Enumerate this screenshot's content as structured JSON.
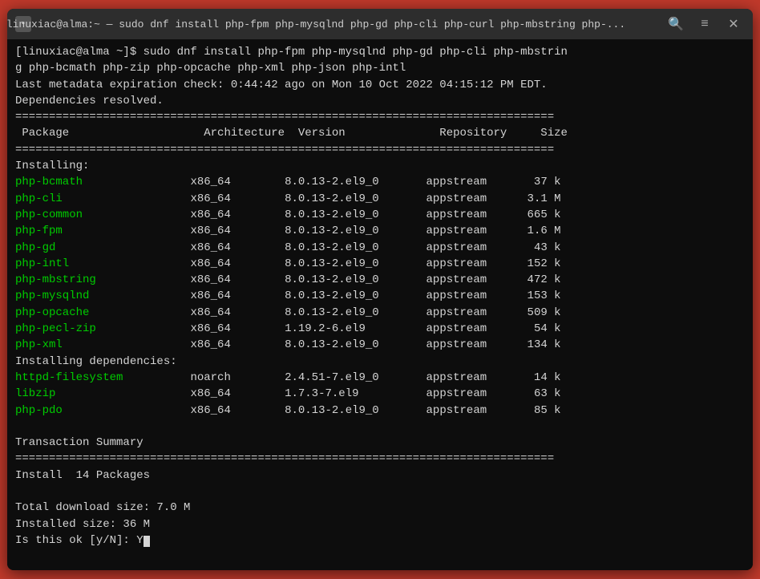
{
  "titleBar": {
    "icon": "■",
    "title": "linuxiac@alma:~ — sudo dnf install php-fpm php-mysqlnd php-gd php-cli php-curl php-mbstring php-...",
    "searchIcon": "🔍",
    "menuIcon": "≡",
    "closeIcon": "✕"
  },
  "terminal": {
    "lines": [
      {
        "type": "prompt",
        "text": "[linuxiac@alma ~]$ sudo dnf install php-fpm php-mysqlnd php-gd php-cli php-mbstrin"
      },
      {
        "type": "normal",
        "text": "g php-bcmath php-zip php-opcache php-xml php-json php-intl"
      },
      {
        "type": "normal",
        "text": "Last metadata expiration check: 0:44:42 ago on Mon 10 Oct 2022 04:15:12 PM EDT."
      },
      {
        "type": "normal",
        "text": "Dependencies resolved."
      },
      {
        "type": "separator",
        "text": "================================================================================"
      },
      {
        "type": "header",
        "text": " Package                    Architecture  Version              Repository     Size"
      },
      {
        "type": "separator",
        "text": "================================================================================"
      },
      {
        "type": "section",
        "text": "Installing:"
      },
      {
        "type": "pkg",
        "name": "php-bcmath",
        "arch": "x86_64",
        "version": "8.0.13-2.el9_0",
        "repo": "appstream",
        "size": "37 k"
      },
      {
        "type": "pkg",
        "name": "php-cli",
        "arch": "x86_64",
        "version": "8.0.13-2.el9_0",
        "repo": "appstream",
        "size": "3.1 M"
      },
      {
        "type": "pkg",
        "name": "php-common",
        "arch": "x86_64",
        "version": "8.0.13-2.el9_0",
        "repo": "appstream",
        "size": "665 k"
      },
      {
        "type": "pkg",
        "name": "php-fpm",
        "arch": "x86_64",
        "version": "8.0.13-2.el9_0",
        "repo": "appstream",
        "size": "1.6 M"
      },
      {
        "type": "pkg",
        "name": "php-gd",
        "arch": "x86_64",
        "version": "8.0.13-2.el9_0",
        "repo": "appstream",
        "size": "43 k"
      },
      {
        "type": "pkg",
        "name": "php-intl",
        "arch": "x86_64",
        "version": "8.0.13-2.el9_0",
        "repo": "appstream",
        "size": "152 k"
      },
      {
        "type": "pkg",
        "name": "php-mbstring",
        "arch": "x86_64",
        "version": "8.0.13-2.el9_0",
        "repo": "appstream",
        "size": "472 k"
      },
      {
        "type": "pkg",
        "name": "php-mysqlnd",
        "arch": "x86_64",
        "version": "8.0.13-2.el9_0",
        "repo": "appstream",
        "size": "153 k"
      },
      {
        "type": "pkg",
        "name": "php-opcache",
        "arch": "x86_64",
        "version": "8.0.13-2.el9_0",
        "repo": "appstream",
        "size": "509 k"
      },
      {
        "type": "pkg",
        "name": "php-pecl-zip",
        "arch": "x86_64",
        "version": "1.19.2-6.el9",
        "repo": "appstream",
        "size": "54 k"
      },
      {
        "type": "pkg",
        "name": "php-xml",
        "arch": "x86_64",
        "version": "8.0.13-2.el9_0",
        "repo": "appstream",
        "size": "134 k"
      },
      {
        "type": "section",
        "text": "Installing dependencies:"
      },
      {
        "type": "pkg",
        "name": "httpd-filesystem",
        "arch": "noarch",
        "version": "2.4.51-7.el9_0",
        "repo": "appstream",
        "size": "14 k"
      },
      {
        "type": "pkg",
        "name": "libzip",
        "arch": "x86_64",
        "version": "1.7.3-7.el9",
        "repo": "appstream",
        "size": "63 k"
      },
      {
        "type": "pkg",
        "name": "php-pdo",
        "arch": "x86_64",
        "version": "8.0.13-2.el9_0",
        "repo": "appstream",
        "size": "85 k"
      },
      {
        "type": "blank"
      },
      {
        "type": "section",
        "text": "Transaction Summary"
      },
      {
        "type": "separator",
        "text": "================================================================================"
      },
      {
        "type": "normal",
        "text": "Install  14 Packages"
      },
      {
        "type": "blank"
      },
      {
        "type": "normal",
        "text": "Total download size: 7.0 M"
      },
      {
        "type": "normal",
        "text": "Installed size: 36 M"
      },
      {
        "type": "prompt_input",
        "text": "Is this ok [y/N]: Y"
      }
    ]
  }
}
